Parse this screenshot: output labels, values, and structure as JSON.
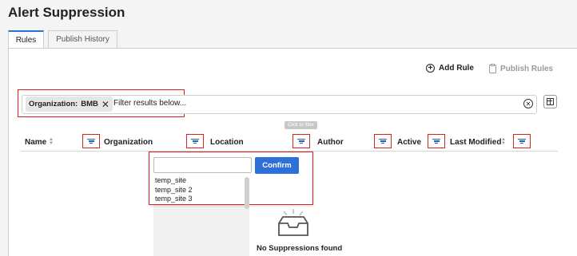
{
  "page": {
    "title": "Alert Suppression"
  },
  "tabs": [
    {
      "label": "Rules",
      "active": true
    },
    {
      "label": "Publish History",
      "active": false
    }
  ],
  "actions": {
    "add_rule": "Add Rule",
    "publish_rules": "Publish Rules"
  },
  "filter_bar": {
    "chip_label": "Organization:",
    "chip_value": "BMB",
    "placeholder": "Filter results below..."
  },
  "tooltip": "Click to filter",
  "columns": [
    {
      "label": "Name",
      "sortable": true
    },
    {
      "label": "Organization",
      "sortable": false
    },
    {
      "label": "Location",
      "sortable": false
    },
    {
      "label": "Author",
      "sortable": false
    },
    {
      "label": "Active",
      "sortable": false
    },
    {
      "label": "Last Modified",
      "sortable": true
    }
  ],
  "dropdown": {
    "input_value": "",
    "confirm_label": "Confirm",
    "options": [
      "temp_site",
      "temp_site 2",
      "temp_site 3"
    ]
  },
  "empty_state": {
    "message": "No Suppressions found"
  },
  "colors": {
    "accent": "#2f6fd8",
    "highlight": "#e02020",
    "filter_icon": "#2b5fad"
  }
}
